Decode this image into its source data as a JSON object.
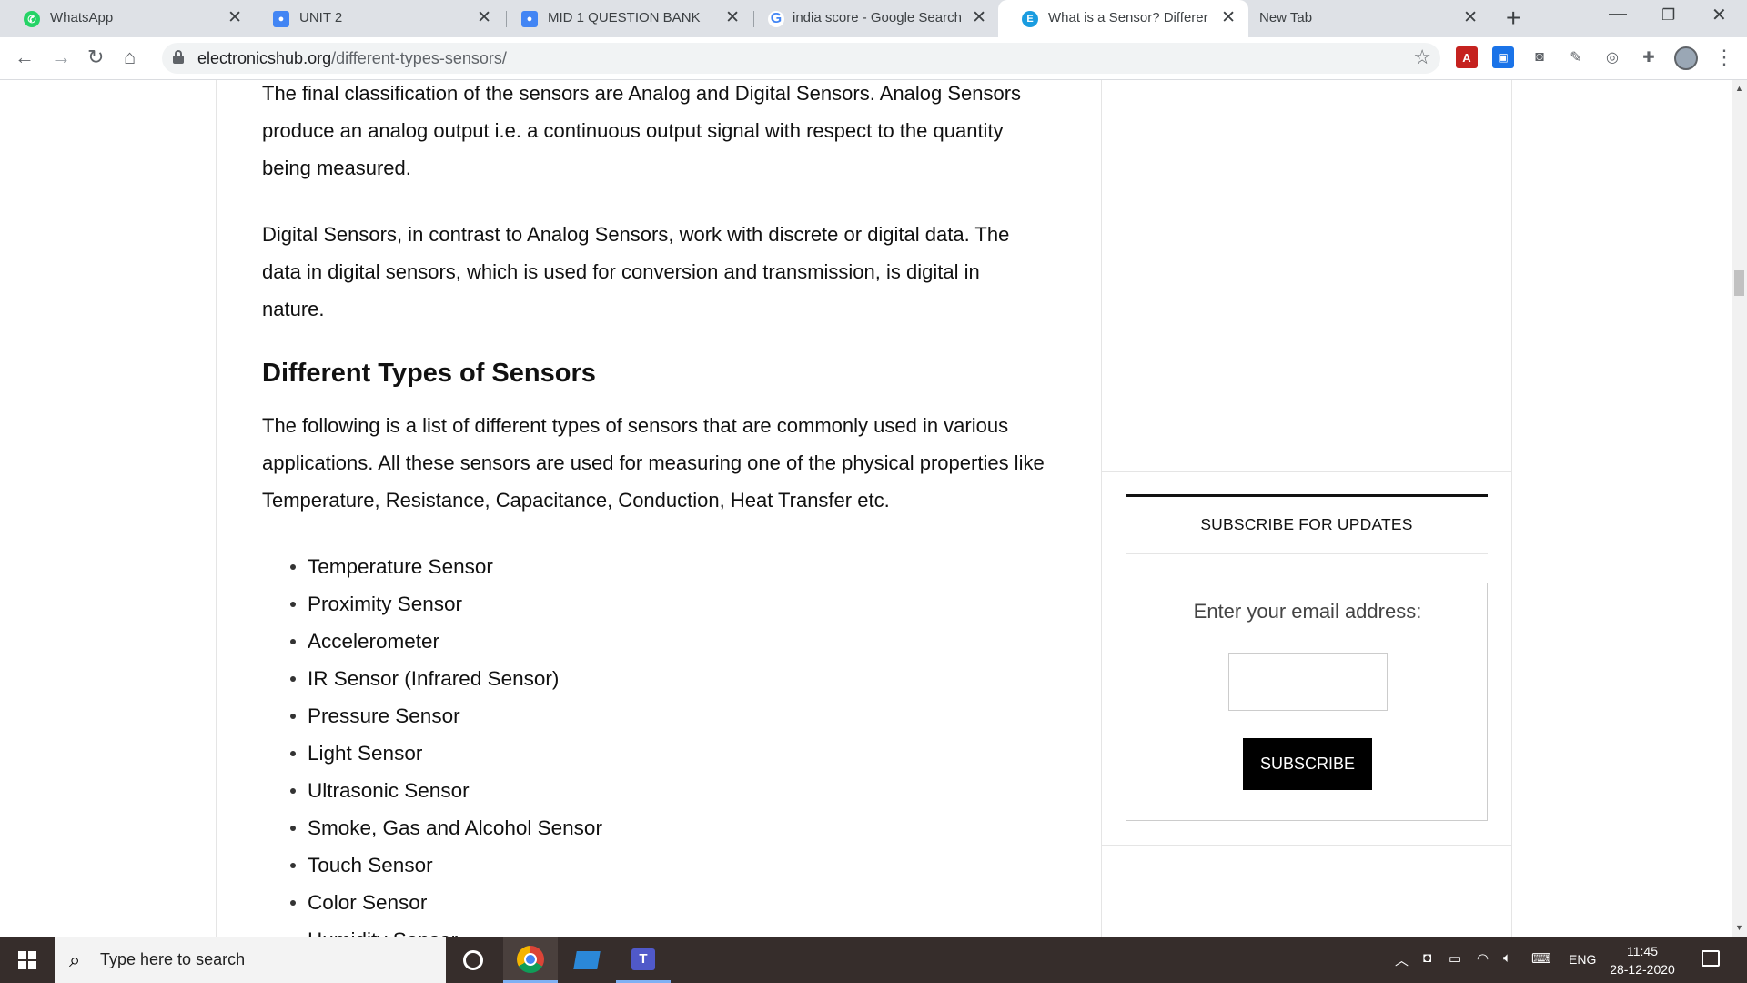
{
  "tabs": [
    {
      "title": "WhatsApp",
      "favicon": "whatsapp-icon",
      "color": "#25d366"
    },
    {
      "title": "UNIT 2",
      "favicon": "classroom-icon",
      "color": "#4285f4"
    },
    {
      "title": "MID 1 QUESTION BANK",
      "favicon": "classroom-icon",
      "color": "#4285f4"
    },
    {
      "title": "india score - Google Search",
      "favicon": "google-icon",
      "color": "#4285f4"
    },
    {
      "title": "What is a Sensor? Different T",
      "favicon": "electronicshub-icon",
      "color": "#1a9ce0"
    },
    {
      "title": "New Tab",
      "favicon": "",
      "color": ""
    }
  ],
  "toolbar": {
    "url_host": "electronicshub.org",
    "url_path": "/different-types-sensors/"
  },
  "article": {
    "para1": "The final classification of the sensors are Analog and Digital Sensors. Analog Sensors produce an analog output i.e. a continuous output signal with respect to the quantity being measured.",
    "para2": "Digital Sensors, in contrast to Analog Sensors, work with discrete or digital data. The data in digital sensors, which is used for conversion and transmission, is digital in nature.",
    "heading": "Different Types of Sensors",
    "para3": "The following is a list of different types of sensors that are commonly used in various applications. All these sensors are used for measuring one of the physical properties like Temperature, Resistance, Capacitance, Conduction, Heat Transfer etc.",
    "sensors": [
      "Temperature Sensor",
      "Proximity Sensor",
      "Accelerometer",
      "IR Sensor (Infrared Sensor)",
      "Pressure Sensor",
      "Light Sensor",
      "Ultrasonic Sensor",
      "Smoke, Gas and Alcohol Sensor",
      "Touch Sensor",
      "Color Sensor",
      "Humidity Sensor"
    ]
  },
  "sidebar": {
    "widget_title": "SUBSCRIBE FOR UPDATES",
    "email_label": "Enter your email address:",
    "email_value": "",
    "subscribe_label": "SUBSCRIBE"
  },
  "taskbar": {
    "search_placeholder": "Type here to search",
    "language": "ENG",
    "time": "11:45",
    "date": "28-12-2020"
  }
}
